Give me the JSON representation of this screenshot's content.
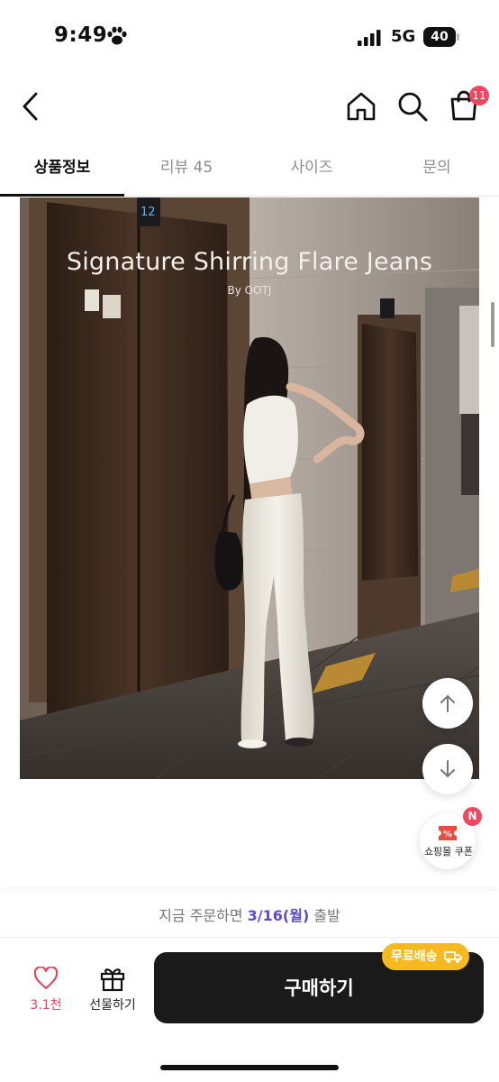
{
  "status_bar": {
    "time": "9:49",
    "network": "5G",
    "battery": "40"
  },
  "header": {
    "cart_count": "11"
  },
  "tabs": [
    {
      "label": "상품정보",
      "active": true
    },
    {
      "label": "리뷰 45",
      "active": false
    },
    {
      "label": "사이즈",
      "active": false
    },
    {
      "label": "문의",
      "active": false
    }
  ],
  "product_image": {
    "title": "Signature Shirring Flare Jeans",
    "subtitle": "By OOTJ",
    "elevator_floor": "12"
  },
  "coupon": {
    "label": "쇼핑몰 쿠폰",
    "badge": "N"
  },
  "shipping": {
    "prefix": "지금 주문하면",
    "date": "3/16(월)",
    "suffix": "출발"
  },
  "actions": {
    "like_count": "3.1천",
    "gift_label": "선물하기",
    "buy_label": "구매하기",
    "free_shipping_label": "무료배송"
  },
  "colors": {
    "accent": "#5b4bd6",
    "badge": "#f04760",
    "like": "#e8455c",
    "free_shipping": "#f7b91d",
    "buy_button": "#1a1a1a"
  },
  "icons": [
    "paw-icon",
    "signal-icon",
    "back-icon",
    "home-icon",
    "search-icon",
    "cart-icon",
    "arrow-up-icon",
    "arrow-down-icon",
    "coupon-icon",
    "heart-icon",
    "gift-icon",
    "truck-icon"
  ]
}
